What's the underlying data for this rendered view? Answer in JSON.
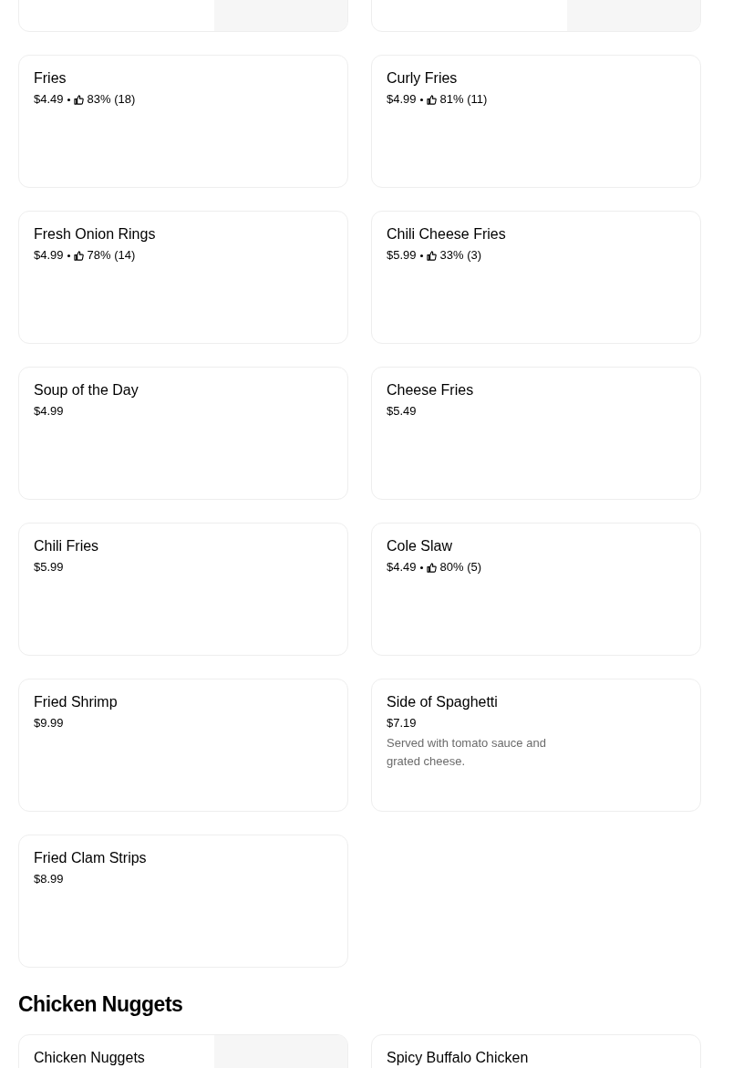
{
  "sections": [
    {
      "items": [
        {
          "image": true
        },
        {
          "image": true
        },
        {
          "name": "Fries",
          "price": "$4.49",
          "rating": "83% (18)",
          "image": false
        },
        {
          "name": "Curly Fries",
          "price": "$4.99",
          "rating": "81% (11)",
          "image": false
        },
        {
          "name": "Fresh Onion Rings",
          "price": "$4.99",
          "rating": "78% (14)",
          "image": false
        },
        {
          "name": "Chili Cheese Fries",
          "price": "$5.99",
          "rating": "33% (3)",
          "image": false
        },
        {
          "name": "Soup of the Day",
          "price": "$4.99",
          "image": false
        },
        {
          "name": "Cheese Fries",
          "price": "$5.49",
          "image": false
        },
        {
          "name": "Chili Fries",
          "price": "$5.99",
          "image": false
        },
        {
          "name": "Cole Slaw",
          "price": "$4.49",
          "rating": "80% (5)",
          "image": false
        },
        {
          "name": "Fried Shrimp",
          "price": "$9.99",
          "image": false
        },
        {
          "name": "Side of Spaghetti",
          "price": "$7.19",
          "description": "Served with tomato sauce and grated cheese.",
          "image": false
        },
        {
          "name": "Fried Clam Strips",
          "price": "$8.99",
          "image": false
        }
      ]
    },
    {
      "title": "Chicken Nuggets",
      "items": [
        {
          "name": "Chicken Nuggets",
          "image": true
        },
        {
          "name": "Spicy Buffalo Chicken",
          "image": false
        }
      ]
    }
  ]
}
